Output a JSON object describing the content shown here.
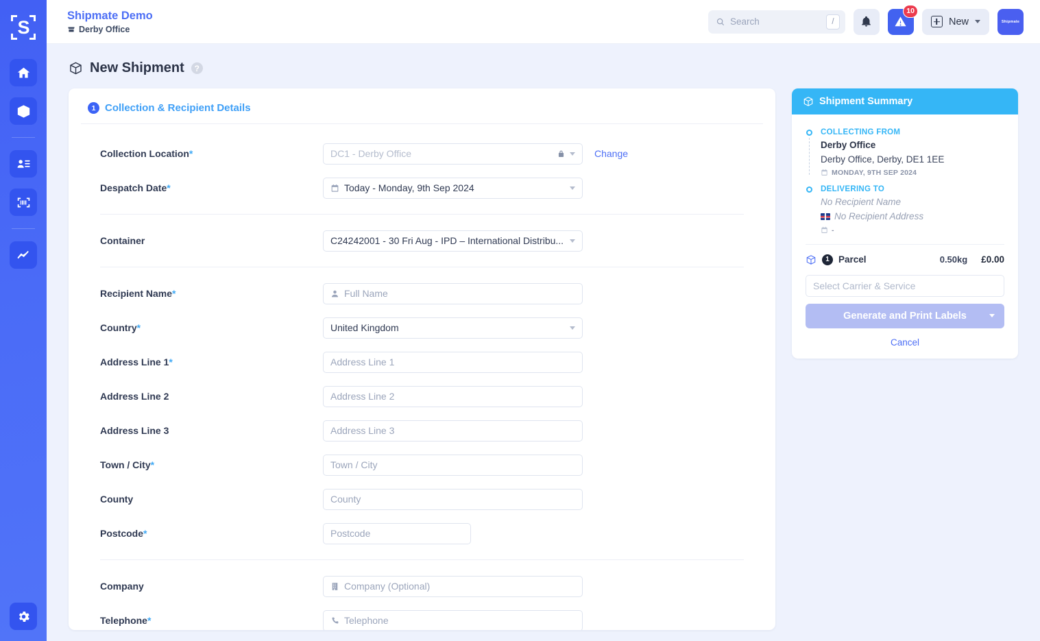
{
  "sidebar": {
    "logo_letter": "S",
    "items": [
      {
        "name": "home",
        "icon": "home-icon"
      },
      {
        "name": "shipments",
        "icon": "package-icon"
      },
      {
        "name": "address-book",
        "icon": "address-book-icon"
      },
      {
        "name": "scanner",
        "icon": "barcode-icon"
      },
      {
        "name": "analytics",
        "icon": "chart-line-icon"
      }
    ],
    "settings_icon": "gear-icon"
  },
  "topbar": {
    "brand_title": "Shipmate Demo",
    "brand_sub": "Derby Office",
    "search_placeholder": "Search",
    "search_shortcut": "/",
    "alert_count": "10",
    "new_label": "New",
    "avatar_label": "Shipmate"
  },
  "page": {
    "title": "New Shipment",
    "help": "?"
  },
  "form": {
    "step_number": "1",
    "section_title": "Collection & Recipient Details",
    "fields": {
      "collection_location": {
        "label": "Collection Location",
        "required": "*",
        "value": "DC1 - Derby Office",
        "change_label": "Change"
      },
      "despatch_date": {
        "label": "Despatch Date",
        "required": "*",
        "value": "Today - Monday, 9th Sep 2024"
      },
      "container": {
        "label": "Container",
        "value": "C24242001 - 30 Fri Aug - IPD – International Distribu..."
      },
      "recipient_name": {
        "label": "Recipient Name",
        "required": "*",
        "placeholder": "Full Name"
      },
      "country": {
        "label": "Country",
        "required": "*",
        "value": "United Kingdom"
      },
      "address_line_1": {
        "label": "Address Line 1",
        "required": "*",
        "placeholder": "Address Line 1"
      },
      "address_line_2": {
        "label": "Address Line 2",
        "required": "",
        "placeholder": "Address Line 2"
      },
      "address_line_3": {
        "label": "Address Line 3",
        "required": "",
        "placeholder": "Address Line 3"
      },
      "town_city": {
        "label": "Town / City",
        "required": "*",
        "placeholder": "Town / City"
      },
      "county": {
        "label": "County",
        "required": "",
        "placeholder": "County"
      },
      "postcode": {
        "label": "Postcode",
        "required": "*",
        "placeholder": "Postcode"
      },
      "company": {
        "label": "Company",
        "required": "",
        "placeholder": "Company (Optional)"
      },
      "telephone": {
        "label": "Telephone",
        "required": "*",
        "placeholder": "Telephone"
      }
    }
  },
  "summary": {
    "header": "Shipment Summary",
    "collecting": {
      "label": "COLLECTING FROM",
      "name": "Derby Office",
      "address": "Derby Office, Derby, DE1 1EE",
      "date": "MONDAY, 9TH SEP 2024"
    },
    "delivering": {
      "label": "DELIVERING TO",
      "name": "No Recipient Name",
      "address": "No Recipient Address",
      "date": "-"
    },
    "parcel": {
      "count": "1",
      "label": "Parcel",
      "weight": "0.50kg",
      "price": "£0.00"
    },
    "carrier_placeholder": "Select Carrier & Service",
    "generate_label": "Generate and Print Labels",
    "cancel_label": "Cancel"
  },
  "colors": {
    "sidebar": "#4a6bf7",
    "brand": "#4c6ef5",
    "summary_header": "#35b6f6",
    "section_title": "#3e9ff7",
    "alert_badge": "#ec3b4e",
    "generate_btn": "#b3bdf3",
    "page_bg": "#eef2fd"
  }
}
